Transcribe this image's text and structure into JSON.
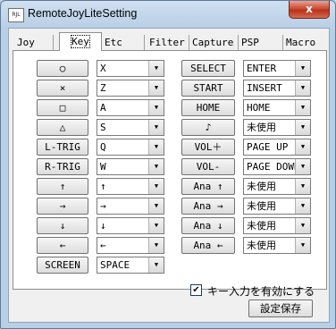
{
  "window": {
    "title": "RemoteJoyLiteSetting",
    "icon_label": "RJL",
    "close_glyph": "x"
  },
  "tabs": [
    {
      "label": "Joy"
    },
    {
      "label": "Key"
    },
    {
      "label": "Etc"
    },
    {
      "label": "Filter"
    },
    {
      "label": "Capture"
    },
    {
      "label": "PSP"
    },
    {
      "label": "Macro"
    }
  ],
  "selected_tab": "Key",
  "left_rows": [
    {
      "button": "○",
      "value": "X"
    },
    {
      "button": "×",
      "value": "Z"
    },
    {
      "button": "□",
      "value": "A"
    },
    {
      "button": "△",
      "value": "S"
    },
    {
      "button": "L-TRIG",
      "value": "Q"
    },
    {
      "button": "R-TRIG",
      "value": "W"
    },
    {
      "button": "↑",
      "value": "↑"
    },
    {
      "button": "→",
      "value": "→"
    },
    {
      "button": "↓",
      "value": "↓"
    },
    {
      "button": "←",
      "value": "←"
    },
    {
      "button": "SCREEN",
      "value": "SPACE"
    }
  ],
  "right_rows": [
    {
      "button": "SELECT",
      "value": "ENTER"
    },
    {
      "button": "START",
      "value": "INSERT"
    },
    {
      "button": "HOME",
      "value": "HOME"
    },
    {
      "button": "♪",
      "value": "未使用"
    },
    {
      "button": "VOL＋",
      "value": "PAGE UP"
    },
    {
      "button": "VOL-",
      "value": "PAGE DOWN"
    },
    {
      "button": "Ana ↑",
      "value": "未使用"
    },
    {
      "button": "Ana →",
      "value": "未使用"
    },
    {
      "button": "Ana ↓",
      "value": "未使用"
    },
    {
      "button": "Ana ←",
      "value": "未使用"
    }
  ],
  "dropdown_arrow": "▼",
  "key_input_checkbox": {
    "label": "キー入力を有効にする",
    "checked": true,
    "mark": "✔"
  },
  "save_button": {
    "label": "設定保存"
  }
}
